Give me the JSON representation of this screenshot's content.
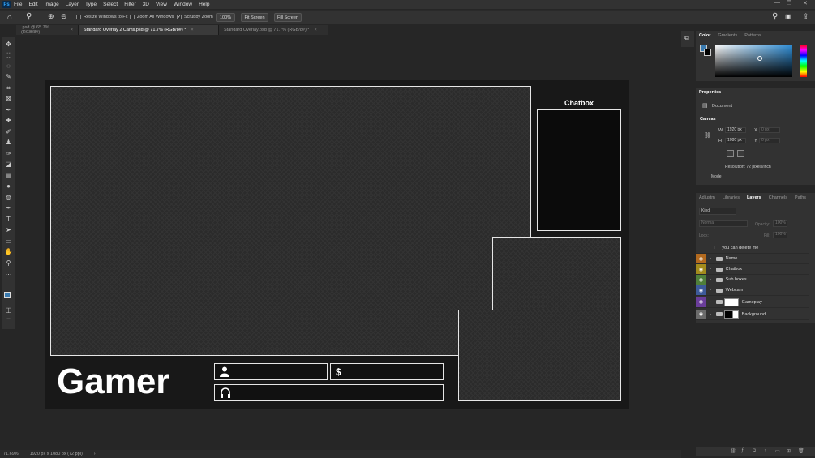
{
  "menubar": {
    "logo": "Ps",
    "items": [
      "File",
      "Edit",
      "Image",
      "Layer",
      "Type",
      "Select",
      "Filter",
      "3D",
      "View",
      "Window",
      "Help"
    ]
  },
  "options": {
    "resize_windows": "Resize Windows to Fit",
    "zoom_all": "Zoom All Windows",
    "scrubby_zoom": "Scrubby Zoom",
    "zoom_100": "100%",
    "fit_screen": "Fit Screen",
    "fill_screen": "Fill Screen"
  },
  "tabs": [
    {
      "label": ".psd @ 65.7% (RGB/8#)",
      "active": false
    },
    {
      "label": "Standard Overlay 2 Cams.psd @ 71.7% (RGB/8#) *",
      "active": true
    },
    {
      "label": "Standard Overlay.psd @ 71.7% (RGB/8#) *",
      "active": false
    }
  ],
  "canvas": {
    "chatbox_title": "Chatbox",
    "gamer_text": "Gamer",
    "icons": {
      "user": "user-icon",
      "dollar": "$",
      "headphones": "headphones-icon"
    }
  },
  "status": {
    "zoom": "71.69%",
    "doc_size": "1920 px x 1080 px (72 ppi)"
  },
  "color_panel": {
    "tabs": [
      "Color",
      "Gradients",
      "Patterns"
    ],
    "foreground": "#3a7bb0"
  },
  "properties": {
    "title": "Properties",
    "doc_label": "Document",
    "canvas_label": "Canvas",
    "w_label": "W",
    "w_value": "1920 px",
    "h_label": "H",
    "h_value": "1080 px",
    "x_label": "X",
    "x_value": "0 px",
    "y_label": "Y",
    "y_value": "0 px",
    "resolution": "Resolution: 72 pixels/inch",
    "mode": "Mode"
  },
  "layers_panel": {
    "tabs": [
      "Adjustm",
      "Libraries",
      "Layers",
      "Channels",
      "Paths"
    ],
    "kind": "Kind",
    "blend": "Normal",
    "opacity_label": "Opacity:",
    "opacity": "100%",
    "lock_label": "Lock:",
    "fill_label": "Fill:",
    "fill": "100%",
    "layers": [
      {
        "name": "you can delete me",
        "type": "text",
        "color": ""
      },
      {
        "name": "Name",
        "type": "group",
        "color": "#b36a1f"
      },
      {
        "name": "Chatbox",
        "type": "group",
        "color": "#a38b1c"
      },
      {
        "name": "Sub boxes",
        "type": "group",
        "color": "#4f7f3a"
      },
      {
        "name": "Webcam",
        "type": "group",
        "color": "#3d5a9a"
      },
      {
        "name": "Gameplay",
        "type": "group",
        "color": "#6a3d9a"
      },
      {
        "name": "Background",
        "type": "group",
        "color": "#6b6b6b"
      }
    ]
  }
}
